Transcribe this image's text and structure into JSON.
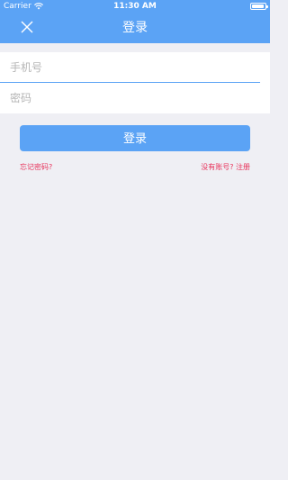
{
  "status": {
    "carrier": "Carrier",
    "time": "11:30 AM",
    "battery_level": 0.9
  },
  "nav": {
    "title": "登录",
    "close_icon": "close-icon"
  },
  "form": {
    "phone_placeholder": "手机号",
    "password_placeholder": "密码"
  },
  "actions": {
    "login_label": "登录",
    "forgot_label": "忘记密码?",
    "register_label": "没有账号? 注册"
  },
  "colors": {
    "primary": "#5ba3f5",
    "link": "#e8325a",
    "background": "#efeff4"
  }
}
